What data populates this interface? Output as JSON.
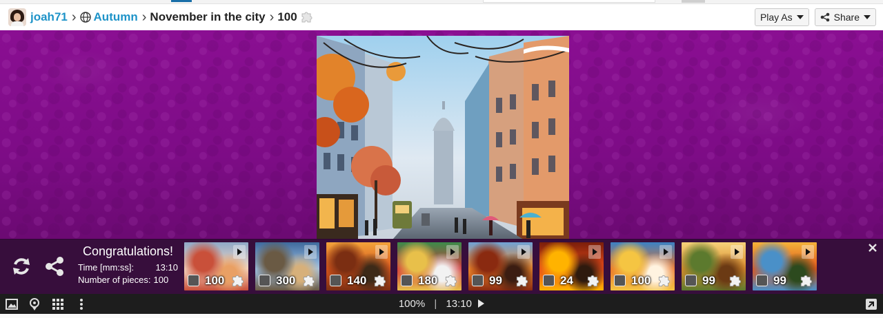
{
  "breadcrumb": {
    "user": "joah71",
    "category": "Autumn",
    "puzzle_title": "November in the city",
    "pieces": "100"
  },
  "header_actions": {
    "play_as_label": "Play As",
    "share_label": "Share"
  },
  "completion": {
    "title": "Congratulations!",
    "time_label": "Time [mm:ss]:",
    "time_value": "13:10",
    "pieces_label": "Number of pieces:",
    "pieces_value": "100"
  },
  "suggestions": [
    {
      "count": "100",
      "palette": [
        "#f3d7c4",
        "#c9503a",
        "#8fa9c7",
        "#e9a064"
      ]
    },
    {
      "count": "300",
      "palette": [
        "#9fc3e8",
        "#6a5a44",
        "#3f6a9c",
        "#d7b07a"
      ]
    },
    {
      "count": "140",
      "palette": [
        "#d8561d",
        "#7b2e12",
        "#f2a33a",
        "#3d2a18"
      ]
    },
    {
      "count": "180",
      "palette": [
        "#d23b3b",
        "#e8c04a",
        "#3b8b4a",
        "#f2f2f2"
      ]
    },
    {
      "count": "99",
      "palette": [
        "#f08a2c",
        "#8a2a10",
        "#6fa3d6",
        "#3b1d12"
      ]
    },
    {
      "count": "24",
      "palette": [
        "#e64a19",
        "#ffb300",
        "#7a1e0a",
        "#2e1a0e"
      ]
    },
    {
      "count": "100",
      "palette": [
        "#e8732a",
        "#f5c542",
        "#3b82c4",
        "#fff3e0"
      ]
    },
    {
      "count": "99",
      "palette": [
        "#d98b2b",
        "#5c7a2e",
        "#f6d27a",
        "#6b3a14"
      ]
    },
    {
      "count": "99",
      "palette": [
        "#e0561c",
        "#4a90c8",
        "#f4b23a",
        "#2c4a1e"
      ]
    }
  ],
  "status_bar": {
    "zoom": "100%",
    "divider": "|",
    "timer": "13:10"
  },
  "colors": {
    "background_purple": "#800e8a",
    "panel": "#2f0434",
    "link_blue": "#1e93c8",
    "bottom_bar": "#1d1d1d"
  },
  "icons": [
    "globe-icon",
    "puzzle-piece-icon",
    "caret-down-icon",
    "share-icon",
    "refresh-icon",
    "close-icon",
    "image-icon",
    "rocket-icon",
    "grid-icon",
    "more-vert-icon",
    "play-icon",
    "fullscreen-icon"
  ]
}
